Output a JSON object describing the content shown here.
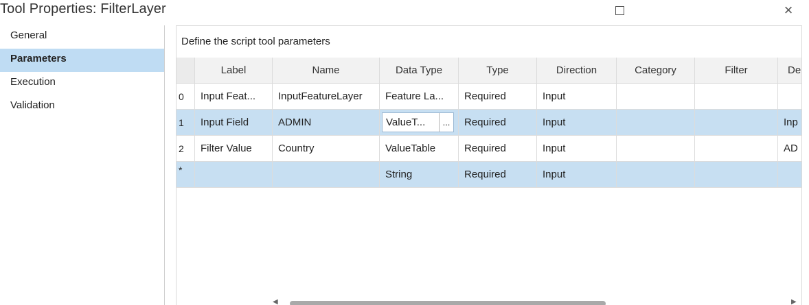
{
  "window": {
    "title": "Tool Properties: FilterLayer",
    "maximize_icon": "maximize-icon",
    "close_icon": "close-icon",
    "close_glyph": "×"
  },
  "sidebar": {
    "items": [
      {
        "label": "General"
      },
      {
        "label": "Parameters",
        "active": true
      },
      {
        "label": "Execution"
      },
      {
        "label": "Validation"
      }
    ]
  },
  "panel": {
    "description": "Define the script tool parameters"
  },
  "table": {
    "columns": [
      "",
      "Label",
      "Name",
      "Data Type",
      "Type",
      "Direction",
      "Category",
      "Filter",
      "Der"
    ],
    "rows": [
      {
        "index": "0",
        "label": "Input Feat...",
        "name": "InputFeatureLayer",
        "data_type": "Feature La...",
        "type": "Required",
        "direction": "Input",
        "category": "",
        "filter": "",
        "dependency": ""
      },
      {
        "index": "1",
        "label": "Input Field",
        "name": "ADMIN",
        "data_type": "ValueT...",
        "data_type_button": "...",
        "type": "Required",
        "direction": "Input",
        "category": "",
        "filter": "",
        "dependency": "Inp"
      },
      {
        "index": "2",
        "label": "Filter Value",
        "name": "Country",
        "data_type": "ValueTable",
        "type": "Required",
        "direction": "Input",
        "category": "",
        "filter": "",
        "dependency": "AD"
      },
      {
        "index": "*",
        "label": "",
        "name": "",
        "data_type": "String",
        "type": "Required",
        "direction": "Input",
        "category": "",
        "filter": "",
        "dependency": ""
      }
    ]
  },
  "colors": {
    "selected_row": "#c7dff2",
    "active_sidebar": "#bfdcf3"
  }
}
